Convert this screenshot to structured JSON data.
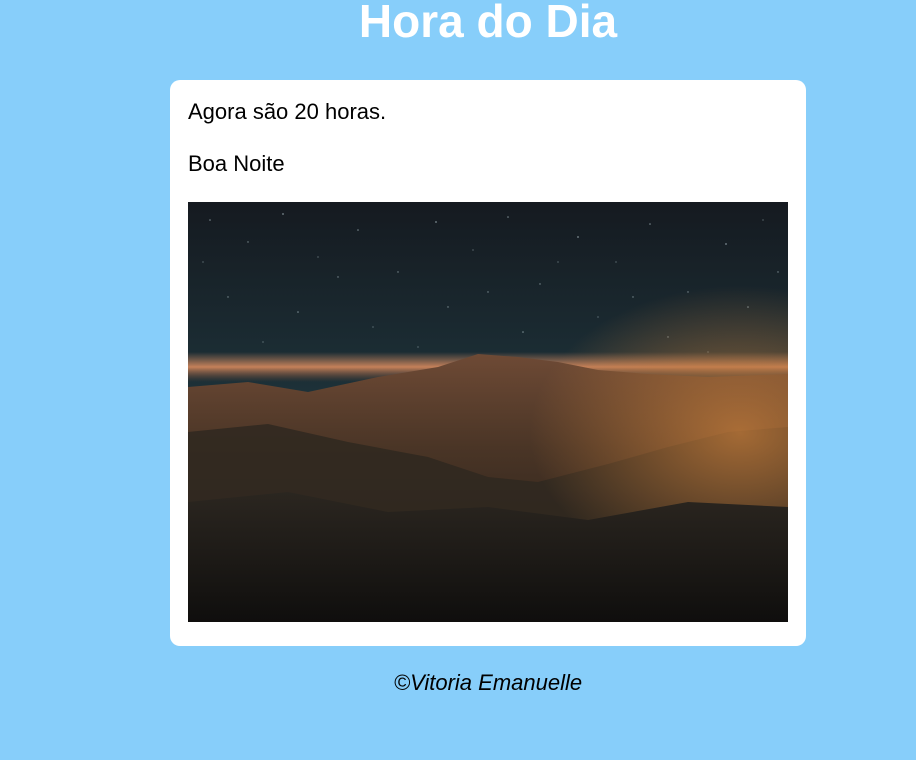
{
  "page": {
    "title": "Hora do Dia",
    "background_color": "#87CEFA"
  },
  "card": {
    "hour_message": "Agora são 20 horas.",
    "greeting": "Boa Noite",
    "image": {
      "description_icon": "night-mountain-landscape"
    }
  },
  "footer": {
    "copyright": "©Vitoria Emanuelle"
  }
}
